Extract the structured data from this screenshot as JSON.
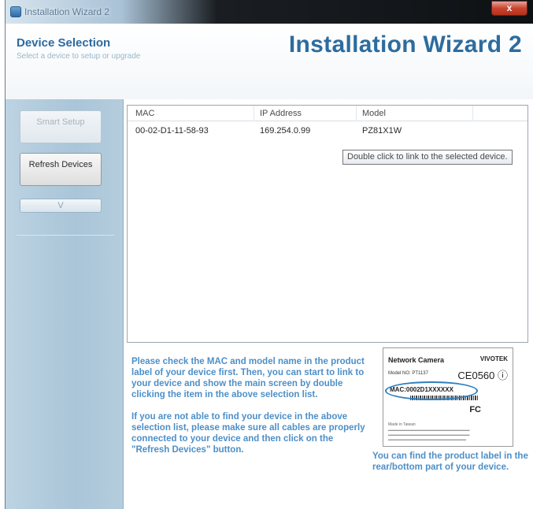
{
  "window": {
    "title": "Installation Wizard 2",
    "close_label": "x"
  },
  "header": {
    "title": "Device Selection",
    "subtitle": "Select a device to setup or upgrade",
    "wizard_title": "Installation Wizard 2"
  },
  "sidebar": {
    "smart_setup_label": "Smart Setup",
    "refresh_devices_label": "Refresh Devices",
    "v_label": "V"
  },
  "device_list": {
    "columns": [
      "MAC",
      "IP Address",
      "Model"
    ],
    "rows": [
      {
        "mac": "00-02-D1-11-58-93",
        "ip": "169.254.0.99",
        "model": "PZ81X1W"
      }
    ],
    "tooltip": "Double click to link to the selected device."
  },
  "instructions": {
    "paragraph_1": "Please check the MAC and model name in the product label of your device first. Then, you can start to link to your device and show the main screen by double clicking the item in the above selection list.",
    "paragraph_2": "If you are not able to find your device in the above selection list, please make sure all cables are properly connected to your device and then click on the \"Refresh Devices\" button."
  },
  "product_label": {
    "title": "Network Camera",
    "brand": "VIVOTEK",
    "model_line": "Model NO: PT1137",
    "cert": "CE0560 ⓘ",
    "mac_line": "MAC:0002D1XXXXXX",
    "fc": "FC",
    "origin": "Made in Taiwan",
    "caption": "You can find the product label in the rear/bottom part of your device."
  },
  "colors": {
    "accent_blue": "#2d6c9e",
    "instruction_blue": "#4d8fc8",
    "panel_blue": "#b4cddd",
    "close_red": "#c8452f"
  }
}
